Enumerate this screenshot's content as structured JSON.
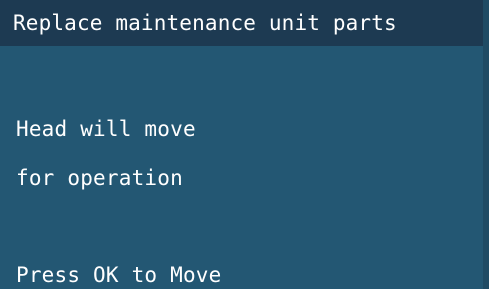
{
  "screen": {
    "title": "Replace maintenance unit parts",
    "lines": [
      "Head will move",
      "for operation",
      "Press OK to Move"
    ]
  },
  "colors": {
    "title_bar_bg": "#1d3a52",
    "screen_bg": "#235773",
    "text": "#ffffff"
  }
}
